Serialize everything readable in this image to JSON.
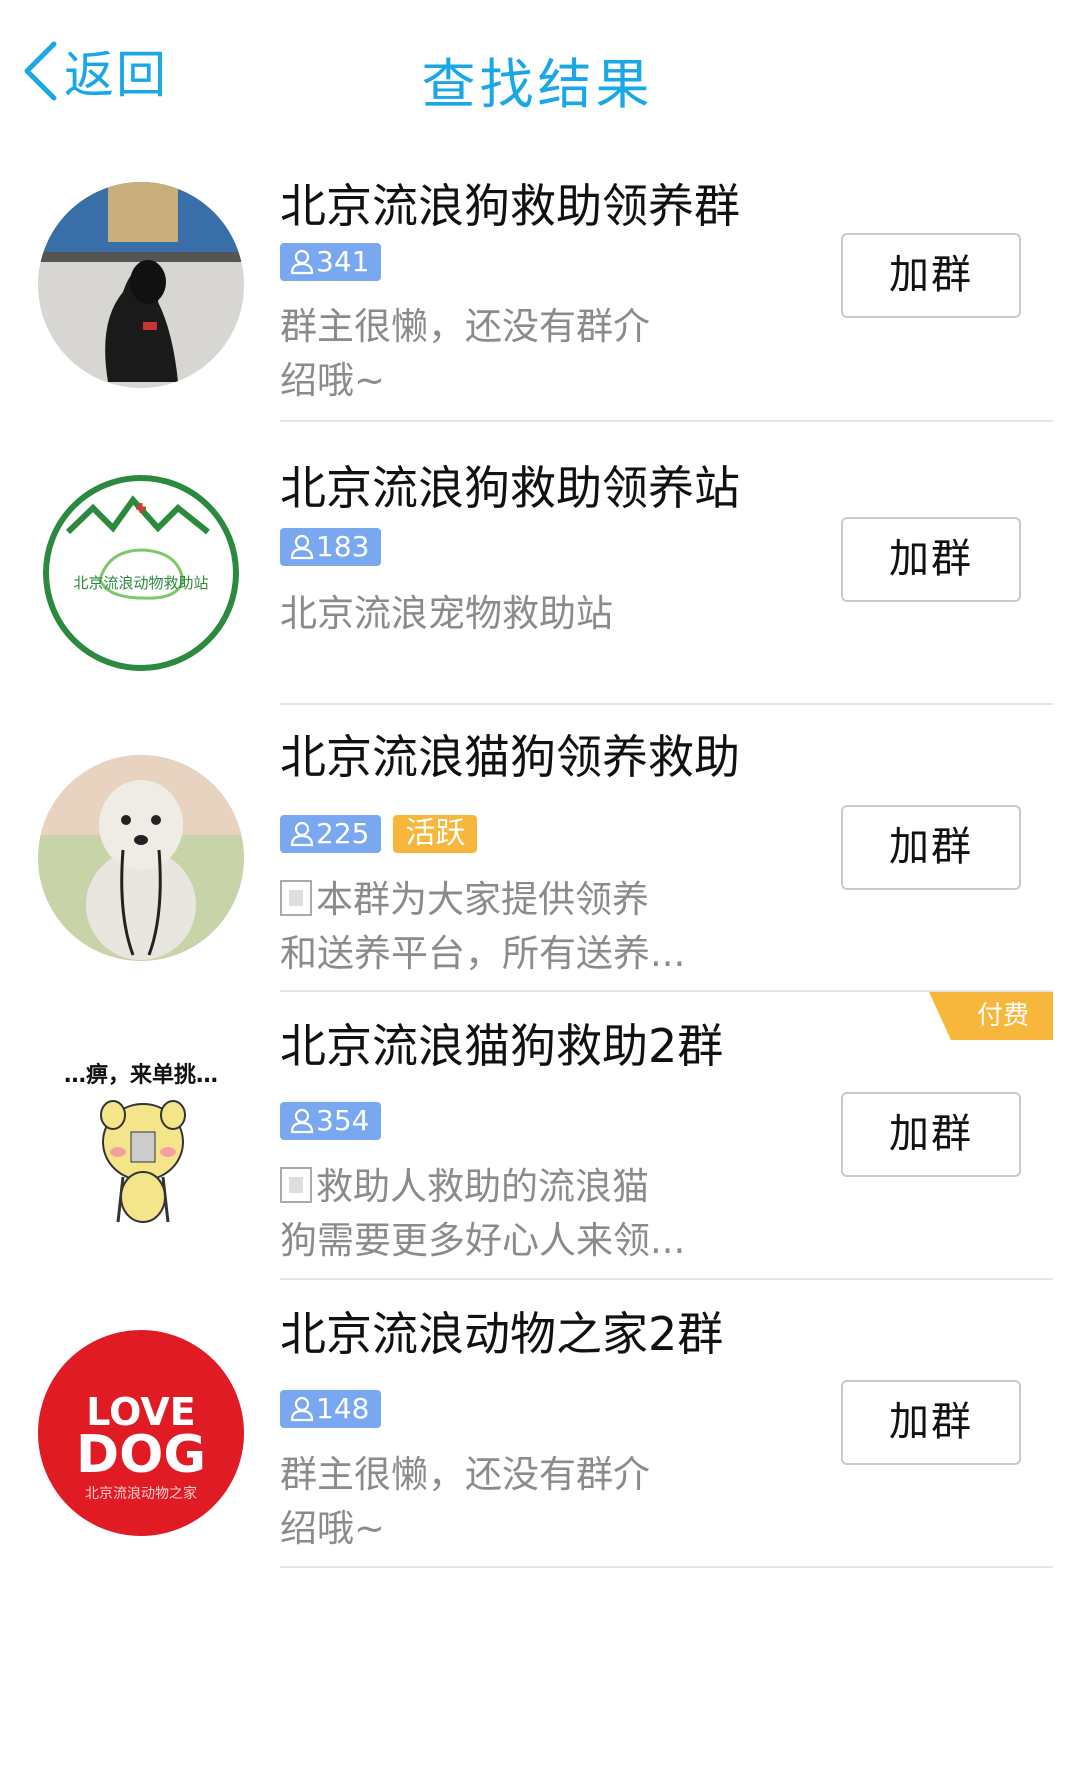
{
  "header": {
    "back_label": "返回",
    "title": "查找结果",
    "accent_color": "#1aa7e8"
  },
  "groups": [
    {
      "name": "北京流浪狗救助领养群",
      "members": "341",
      "desc_lines": [
        "群主很懒，还没有群介",
        "绍哦~"
      ],
      "join_label": "加群",
      "avatar": "black-dog-photo"
    },
    {
      "name": "北京流浪狗救助领养站",
      "members": "183",
      "desc_lines": [
        "北京流浪宠物救助站"
      ],
      "join_label": "加群",
      "avatar": "rescue-station-logo",
      "avatar_text": "北京流浪动物救助站"
    },
    {
      "name": "北京流浪猫狗领养救助",
      "members": "225",
      "active_label": "活跃",
      "desc_lines": [
        "本群为大家提供领养",
        "和送养平台，所有送养..."
      ],
      "desc_has_icon": true,
      "join_label": "加群",
      "avatar": "white-poodle-photo"
    },
    {
      "name": "北京流浪猫狗救助2群",
      "members": "354",
      "paid_label": "付费",
      "desc_lines": [
        "救助人救助的流浪猫",
        "狗需要更多好心人来领..."
      ],
      "desc_has_icon": true,
      "join_label": "加群",
      "avatar": "cartoon-dog-meme",
      "avatar_text": "…痹，来单挑…"
    },
    {
      "name": "北京流浪动物之家2群",
      "members": "148",
      "desc_lines": [
        "群主很懒，还没有群介",
        "绍哦~"
      ],
      "join_label": "加群",
      "avatar": "love-dog-logo",
      "avatar_text_1": "LOVE",
      "avatar_text_2": "DOG",
      "avatar_text_3": "北京流浪动物之家"
    }
  ]
}
